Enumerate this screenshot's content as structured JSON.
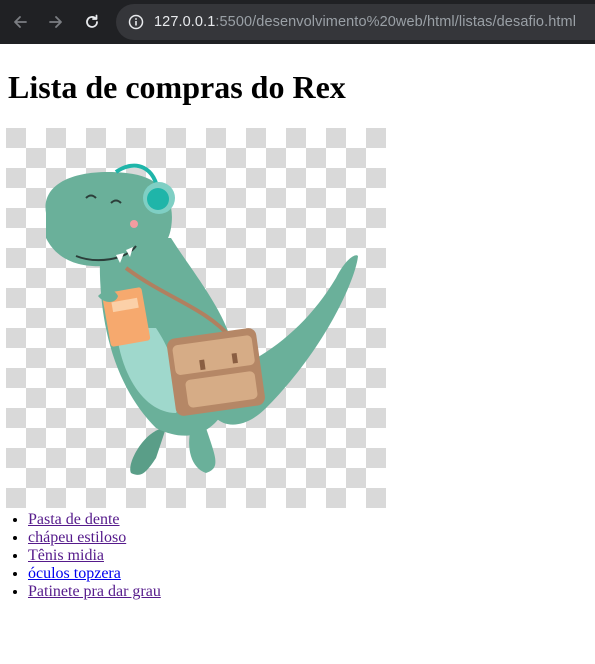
{
  "browser": {
    "url_host": "127.0.0.1",
    "url_path": ":5500/desenvolvimento%20web/html/listas/desafio.html"
  },
  "page": {
    "title": "Lista de compras do Rex",
    "image_alt": "dinossauro"
  },
  "list": {
    "items": [
      {
        "label": "Pasta de dente"
      },
      {
        "label": "chápeu estiloso"
      },
      {
        "label": "Tênis midia"
      },
      {
        "label": "óculos topzera"
      },
      {
        "label": "Patinete pra dar grau"
      }
    ]
  },
  "colors": {
    "visited_link": "#551a8b",
    "unvisited_link": "#0000ee",
    "toolbar_bg": "#202124",
    "dino": "#6ab09a"
  }
}
